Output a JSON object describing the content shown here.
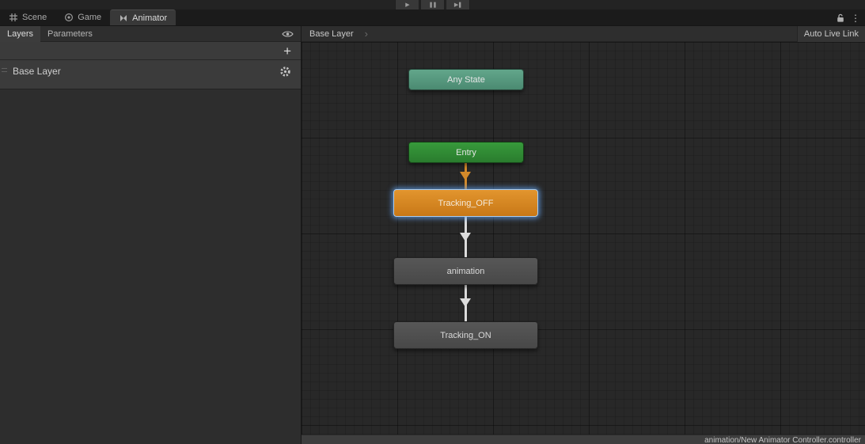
{
  "window": {
    "toolbar": {
      "play": "▶",
      "pause": "❚❚",
      "step": "▶❚"
    },
    "tabs": [
      {
        "label": "Scene",
        "icon": "grid-icon",
        "active": false
      },
      {
        "label": "Game",
        "icon": "game-icon",
        "active": false
      },
      {
        "label": "Animator",
        "icon": "animator-icon",
        "active": true
      }
    ],
    "menu_icon": "⋮"
  },
  "left_panel": {
    "tabs": [
      {
        "label": "Layers",
        "active": true
      },
      {
        "label": "Parameters",
        "active": false
      }
    ],
    "add_button_label": "+",
    "layers": [
      {
        "name": "Base Layer"
      }
    ]
  },
  "graph": {
    "breadcrumb": "Base Layer",
    "breadcrumb_separator": "›",
    "auto_live_link_label": "Auto Live Link",
    "status_text": "animation/New Animator Controller.controller",
    "nodes": [
      {
        "label": "Any State",
        "type": "any-state",
        "color": "#4e8f76",
        "selected": false
      },
      {
        "label": "Entry",
        "type": "entry",
        "color": "#2f8a33",
        "selected": false
      },
      {
        "label": "Tracking_OFF",
        "type": "orange-selected",
        "color": "#d1821f",
        "selected": true
      },
      {
        "label": "animation",
        "type": "normal",
        "color": "#4d4d4d",
        "selected": false
      },
      {
        "label": "Tracking_ON",
        "type": "normal",
        "color": "#4d4d4d",
        "selected": false
      }
    ],
    "transitions": [
      {
        "from": "Entry",
        "to": "Tracking_OFF",
        "color": "#d2892a"
      },
      {
        "from": "Tracking_OFF",
        "to": "animation",
        "color": "#dcdcdc"
      },
      {
        "from": "animation",
        "to": "Tracking_ON",
        "color": "#dcdcdc"
      }
    ],
    "selection_outline_color": "#a9cdf2"
  }
}
